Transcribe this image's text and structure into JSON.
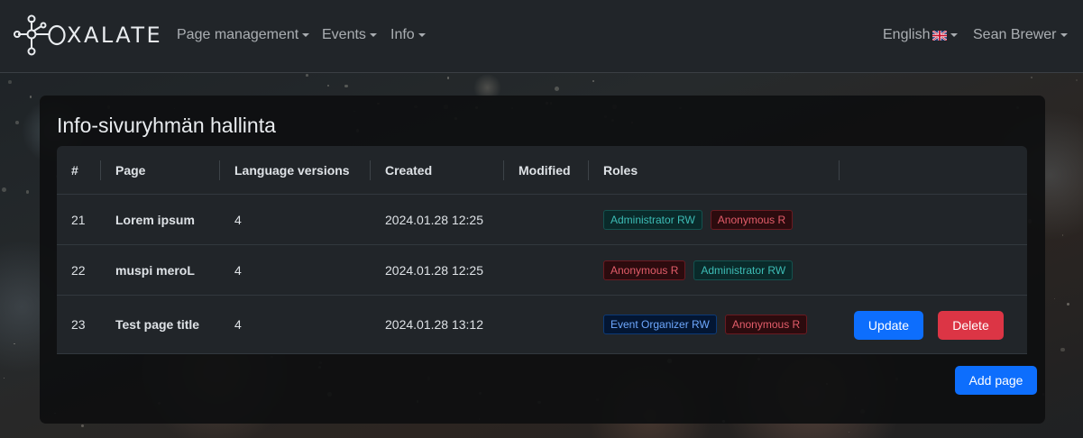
{
  "brand": {
    "logo_icon": "molecule-logo-icon",
    "text": "XALATE"
  },
  "nav": {
    "items": [
      {
        "label": "Page management"
      },
      {
        "label": "Events"
      },
      {
        "label": "Info"
      }
    ],
    "language": {
      "label": "English",
      "flag_icon": "uk-flag-icon"
    },
    "user": {
      "label": "Sean Brewer"
    }
  },
  "card": {
    "title": "Info-sivuryhmän hallinta",
    "table": {
      "headers": [
        "#",
        "Page",
        "Language versions",
        "Created",
        "Modified",
        "Roles",
        ""
      ],
      "rows": [
        {
          "id": "21",
          "page": "Lorem ipsum",
          "languages": "4",
          "created": "2024.01.28 12:25",
          "modified": "",
          "roles": [
            {
              "label": "Administrator RW",
              "color": "teal"
            },
            {
              "label": "Anonymous R",
              "color": "red"
            }
          ]
        },
        {
          "id": "22",
          "page": "muspi meroL",
          "languages": "4",
          "created": "2024.01.28 12:25",
          "modified": "",
          "roles": [
            {
              "label": "Anonymous R",
              "color": "red"
            },
            {
              "label": "Administrator RW",
              "color": "teal"
            }
          ]
        },
        {
          "id": "23",
          "page": "Test page title",
          "languages": "4",
          "created": "2024.01.28 13:12",
          "modified": "",
          "roles": [
            {
              "label": "Event Organizer RW",
              "color": "blue"
            },
            {
              "label": "Anonymous R",
              "color": "red"
            }
          ],
          "actions": {
            "update": "Update",
            "delete": "Delete"
          }
        }
      ]
    },
    "add_button": "Add page"
  },
  "colors": {
    "navbar": "#212529",
    "primary": "#0d6efd",
    "danger": "#dc3545"
  }
}
